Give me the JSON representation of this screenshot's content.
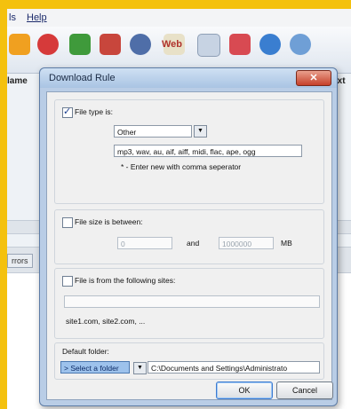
{
  "menu": {
    "item_partial": "ls",
    "help": "Help"
  },
  "toolbar": {
    "web_label": "Web",
    "icons": [
      "pause-icon",
      "stop-icon",
      "add-icon",
      "delete-icon",
      "settings-icon",
      "web-icon",
      "search-icon",
      "bookmark-icon",
      "info-icon",
      "help-icon"
    ]
  },
  "background": {
    "col_name_partial": "lame",
    "col_right_partial": "Ext",
    "errors_partial": "rrors"
  },
  "dialog": {
    "title": "Download Rule",
    "close": "✕",
    "file_type": {
      "label": "File type is:",
      "checked": true,
      "category": "Other",
      "extensions": "mp3, wav, au, aif, aiff, midi, flac, ape, ogg",
      "hint": "* - Enter new with comma seperator"
    },
    "file_size": {
      "label": "File size is between:",
      "checked": false,
      "min": "0",
      "and_label": "and",
      "max": "1000000",
      "unit": "MB"
    },
    "sites": {
      "label": "File is from the following sites:",
      "checked": false,
      "value": "",
      "hint": "site1.com, site2.com, ..."
    },
    "folder": {
      "label": "Default folder:",
      "select_label": "> Select a folder",
      "path": "C:\\Documents and Settings\\Administrato"
    },
    "buttons": {
      "ok": "OK",
      "cancel": "Cancel"
    }
  }
}
